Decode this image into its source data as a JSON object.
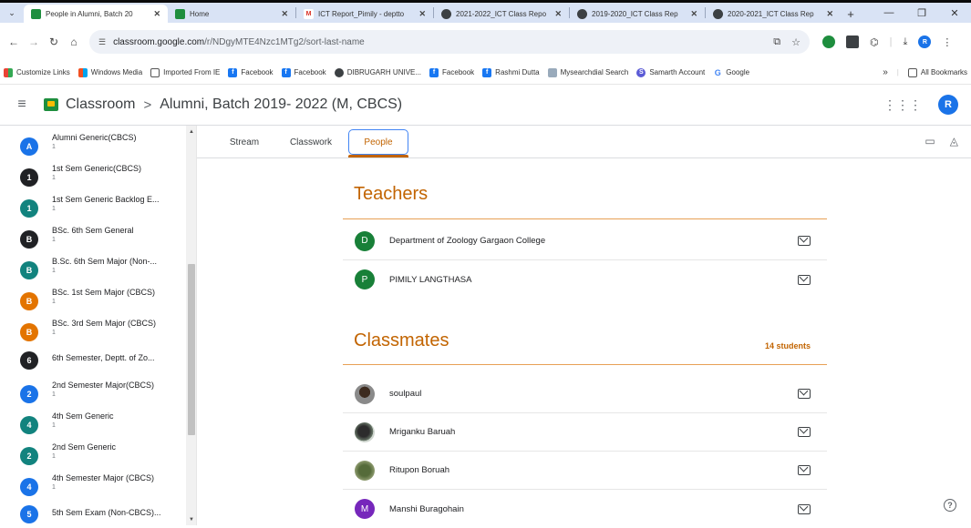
{
  "browser": {
    "tabs": [
      {
        "title": "People in Alumni, Batch 20",
        "active": true,
        "favicon_color": "#1e8e3e",
        "favicon_icon": "classroom-icon"
      },
      {
        "title": "Home",
        "active": false,
        "favicon_color": "#1e8e3e",
        "favicon_icon": "classroom-icon"
      },
      {
        "title": "ICT Report_Pimily - deptto",
        "active": false,
        "favicon_color": "#d93025",
        "favicon_icon": "gmail-icon"
      },
      {
        "title": "2021-2022_ICT Class Repo",
        "active": false,
        "favicon_color": "#3c4043",
        "favicon_icon": "chatgpt-icon"
      },
      {
        "title": "2019-2020_ICT Class Rep",
        "active": false,
        "favicon_color": "#3c4043",
        "favicon_icon": "chatgpt-icon"
      },
      {
        "title": "2020-2021_ICT Class Rep",
        "active": false,
        "favicon_color": "#3c4043",
        "favicon_icon": "chatgpt-icon"
      }
    ],
    "new_tab": "+",
    "window_controls": {
      "minimize": "—",
      "restore": "❐",
      "close": "✕"
    },
    "url_host": "classroom.google.com",
    "url_path": "/r/NDgyMTE4Nzc1MTg2/sort-last-name",
    "profile_initial": "R",
    "bookmarks": [
      {
        "label": "Customize Links",
        "icon_color": "#ea4335"
      },
      {
        "label": "Windows Media",
        "icon_color": "#0078d4"
      },
      {
        "label": "Imported From IE",
        "icon_color": "folder"
      },
      {
        "label": "Facebook",
        "icon_color": "#1877f2"
      },
      {
        "label": "Facebook",
        "icon_color": "#1877f2"
      },
      {
        "label": "DIBRUGARH UNIVE...",
        "icon_color": "#3c4043"
      },
      {
        "label": "Facebook",
        "icon_color": "#1877f2"
      },
      {
        "label": "Rashmi Dutta",
        "icon_color": "#1877f2"
      },
      {
        "label": "Mysearchdial Search",
        "icon_color": "#9ab"
      },
      {
        "label": "Samarth Account",
        "icon_color": "#5b5bd6"
      },
      {
        "label": "Google",
        "icon_color": "#4285f4"
      }
    ],
    "bookmarks_overflow": "»",
    "all_bookmarks": "All Bookmarks"
  },
  "header": {
    "app_name": "Classroom",
    "separator": ">",
    "course_title": "Alumni, Batch 2019- 2022 (M, CBCS)",
    "user_initial": "R"
  },
  "sidebar": {
    "items": [
      {
        "name": "Alumni Generic(CBCS)",
        "count": "1",
        "initial": "A",
        "color": "#1a73e8"
      },
      {
        "name": "1st Sem Generic(CBCS)",
        "count": "1",
        "initial": "1",
        "color": "#202124"
      },
      {
        "name": "1st Sem Generic Backlog E...",
        "count": "1",
        "initial": "1",
        "color": "#12837e"
      },
      {
        "name": "BSc. 6th Sem General",
        "count": "1",
        "initial": "B",
        "color": "#202124"
      },
      {
        "name": "B.Sc. 6th Sem Major (Non-...",
        "count": "1",
        "initial": "B",
        "color": "#12837e"
      },
      {
        "name": "BSc. 1st Sem Major (CBCS)",
        "count": "1",
        "initial": "B",
        "color": "#e37400"
      },
      {
        "name": "BSc. 3rd Sem Major (CBCS)",
        "count": "1",
        "initial": "B",
        "color": "#e37400"
      },
      {
        "name": "6th Semester, Deptt. of Zo...",
        "count": "",
        "initial": "6",
        "color": "#202124"
      },
      {
        "name": "2nd Semester Major(CBCS)",
        "count": "1",
        "initial": "2",
        "color": "#1a73e8"
      },
      {
        "name": "4th Sem Generic",
        "count": "1",
        "initial": "4",
        "color": "#12837e"
      },
      {
        "name": "2nd Sem Generic",
        "count": "1",
        "initial": "2",
        "color": "#12837e"
      },
      {
        "name": "4th Semester Major (CBCS)",
        "count": "1",
        "initial": "4",
        "color": "#1a73e8"
      },
      {
        "name": "5th Sem Exam (Non-CBCS)...",
        "count": "",
        "initial": "5",
        "color": "#1a73e8"
      }
    ]
  },
  "subtabs": {
    "stream": "Stream",
    "classwork": "Classwork",
    "people": "People",
    "active": "People"
  },
  "teachers": {
    "title": "Teachers",
    "list": [
      {
        "name": "Department of Zoology Gargaon College",
        "initial": "D",
        "color": "#188038"
      },
      {
        "name": "PIMILY LANGTHASA",
        "initial": "P",
        "color": "#188038"
      }
    ]
  },
  "classmates": {
    "title": "Classmates",
    "count_label": "14 students",
    "list": [
      {
        "name": "soulpaul",
        "avatar": "photo"
      },
      {
        "name": "Mriganku Baruah",
        "avatar": "photo"
      },
      {
        "name": "Ritupon Boruah",
        "avatar": "photo"
      },
      {
        "name": "Manshi Buragohain",
        "initial": "M",
        "color": "#7627bb"
      }
    ]
  },
  "help": "?"
}
